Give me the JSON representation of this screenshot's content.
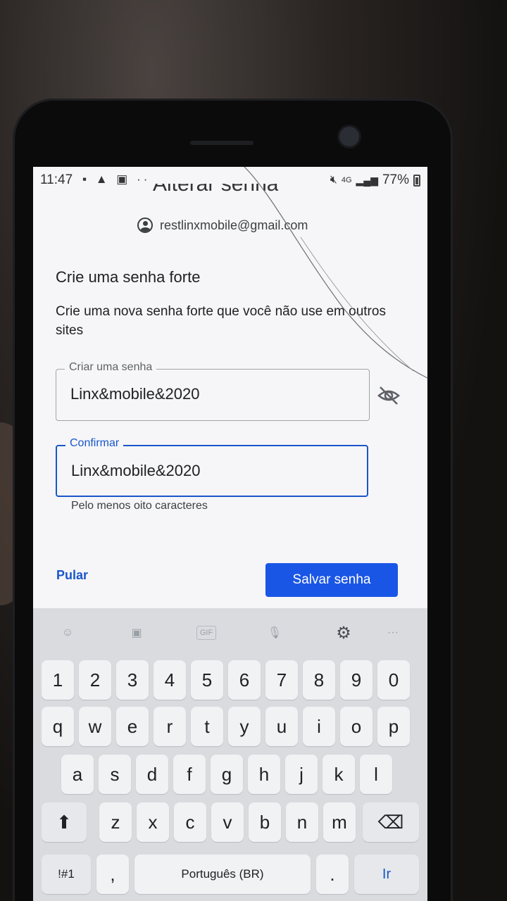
{
  "status_bar": {
    "time": "11:47",
    "left_icons": "▪ ▲ ▣ ··",
    "network": "4G",
    "battery": "77%"
  },
  "header": {
    "title": "Alterar senha",
    "account_email": "restlinxmobile@gmail.com"
  },
  "main": {
    "heading": "Crie uma senha forte",
    "description": "Crie uma nova senha forte que você não use em outros sites",
    "password_field": {
      "label": "Criar uma senha",
      "value": "Linx&mobile&2020"
    },
    "confirm_field": {
      "label": "Confirmar",
      "value": "Linx&mobile&2020"
    },
    "hint": "Pelo menos oito caracteres",
    "skip_label": "Pular",
    "save_label": "Salvar senha"
  },
  "keyboard": {
    "toolbar": [
      "emoji-icon",
      "sticker-icon",
      "GIF",
      "mic-icon",
      "gear-icon",
      "more-icon"
    ],
    "gif_label": "GIF",
    "row_numbers": [
      "1",
      "2",
      "3",
      "4",
      "5",
      "6",
      "7",
      "8",
      "9",
      "0"
    ],
    "row1": [
      "q",
      "w",
      "e",
      "r",
      "t",
      "y",
      "u",
      "i",
      "o",
      "p"
    ],
    "row2": [
      "a",
      "s",
      "d",
      "f",
      "g",
      "h",
      "j",
      "k",
      "l"
    ],
    "row3": [
      "z",
      "x",
      "c",
      "v",
      "b",
      "n",
      "m"
    ],
    "symbols_label": "!#1",
    "comma_label": ",",
    "space_label": "Português (BR)",
    "period_label": ".",
    "enter_label": "Ir"
  }
}
